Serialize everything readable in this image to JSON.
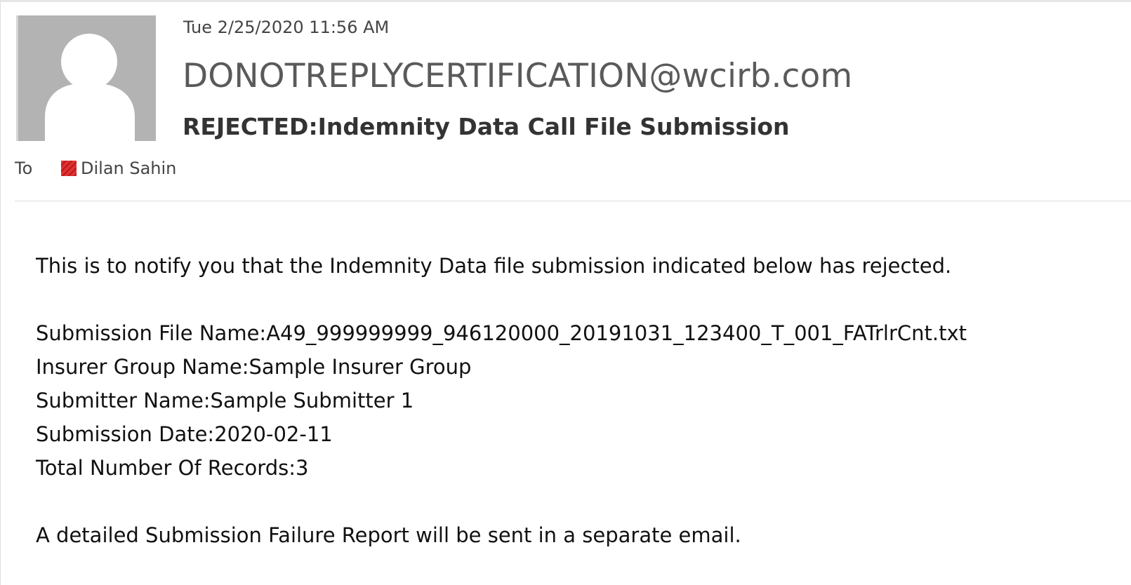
{
  "message": {
    "date": "Tue 2/25/2020 11:56 AM",
    "sender": "DONOTREPLYCERTIFICATION@wcirb.com",
    "subject": "REJECTED:Indemnity Data Call File Submission",
    "to_label": "To",
    "recipient": "Dilan Sahin",
    "avatar_icon": "default-person-icon",
    "presence_icon": "presence-status-icon",
    "body": {
      "intro": "This is to notify you that the Indemnity Data file submission indicated below has rejected.",
      "file_name": "Submission File Name:A49_999999999_946120000_20191031_123400_T_001_FATrlrCnt.txt",
      "insurer_group": "Insurer Group Name:Sample Insurer Group",
      "submitter": "Submitter Name:Sample Submitter 1",
      "submission_date": "Submission Date:2020-02-11",
      "total_records": "Total Number Of Records:3",
      "closing": "A detailed Submission Failure Report will be sent in a separate email."
    }
  },
  "colors": {
    "avatar_bg": "#b3b3b3",
    "presence": "#e03030",
    "divider": "#dcdcdc"
  }
}
